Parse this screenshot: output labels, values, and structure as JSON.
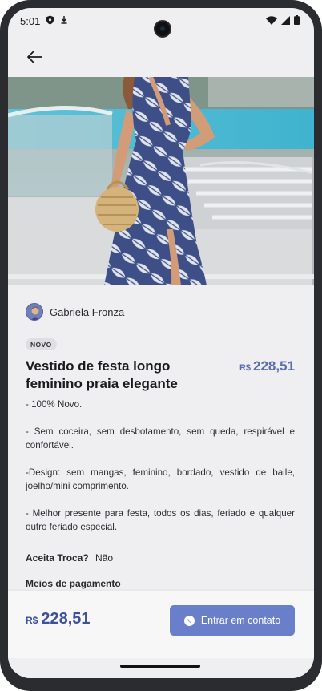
{
  "status_bar": {
    "time": "5:01",
    "icons": [
      "shield-icon",
      "download-icon",
      "wifi-icon",
      "signal-icon",
      "battery-icon"
    ]
  },
  "header": {
    "back_icon": "arrow-left-icon"
  },
  "product": {
    "seller_name": "Gabriela Fronza",
    "badge": "NOVO",
    "title": "Vestido de festa longo feminino praia elegante",
    "currency": "R$",
    "price": "228,51",
    "description": [
      "- 100% Novo.",
      "- Sem coceira, sem desbotamento, sem queda, respirável e confortável.",
      "-Design: sem mangas, feminino, bordado, vestido de baile, joelho/mini comprimento.",
      "- Melhor presente para festa, todos os dias, feriado e qualquer outro feriado especial."
    ],
    "exchange_label": "Aceita Troca?",
    "exchange_value": "Não",
    "payment_title": "Meios de pagamento"
  },
  "bottom_bar": {
    "currency": "R$",
    "price": "228,51",
    "contact_label": "Entrar em contato",
    "contact_icon": "whatsapp-icon"
  },
  "colors": {
    "accent": "#6a7fca",
    "price_text": "#5a6cb4",
    "background": "#efeff1"
  }
}
